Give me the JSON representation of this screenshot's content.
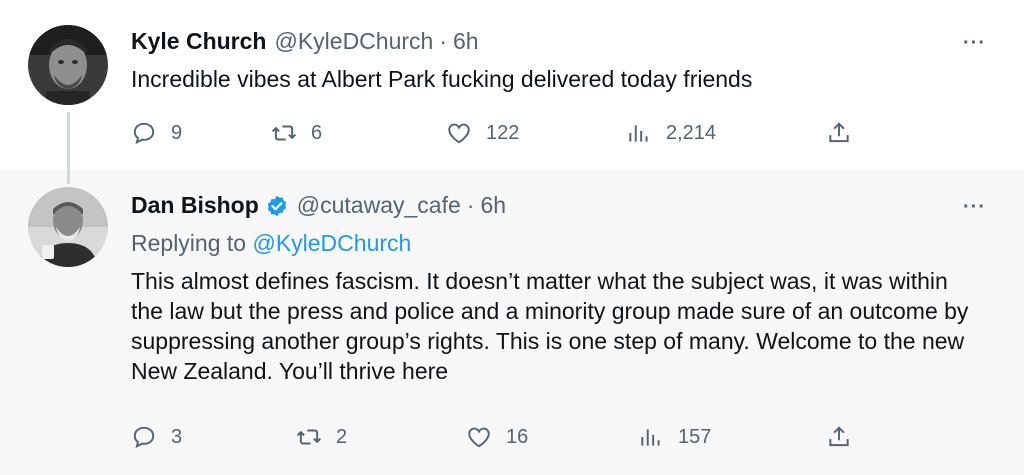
{
  "tweets": [
    {
      "name": "Kyle Church",
      "handle": "@KyleDChurch",
      "separator": "·",
      "time": "6h",
      "text": "Incredible vibes at Albert Park fucking delivered today friends",
      "more": "···",
      "replies": "9",
      "retweets": "6",
      "likes": "122",
      "views": "2,214"
    },
    {
      "name": "Dan Bishop",
      "handle": "@cutaway_cafe",
      "separator": "·",
      "time": "6h",
      "verified": true,
      "replying_label": "Replying to",
      "replying_to": "@KyleDChurch",
      "text": "This almost defines fascism. It doesn’t matter what the subject was, it was within the law but the press and police and a minority group made sure of an outcome by suppressing another group’s rights. This is one step of many. Welcome to the new New Zealand. You’ll thrive here",
      "more": "···",
      "replies": "3",
      "retweets": "2",
      "likes": "16",
      "views": "157"
    }
  ],
  "colors": {
    "text": "#0f1419",
    "secondary": "#536471",
    "link": "#1d9bf0",
    "verified": "#1d9bf0",
    "thread_line": "#cfd9de",
    "reply_bg": "#f7f7f7"
  },
  "icons": [
    "reply-icon",
    "retweet-icon",
    "like-icon",
    "views-icon",
    "share-icon",
    "more-icon",
    "verified-badge-icon"
  ]
}
